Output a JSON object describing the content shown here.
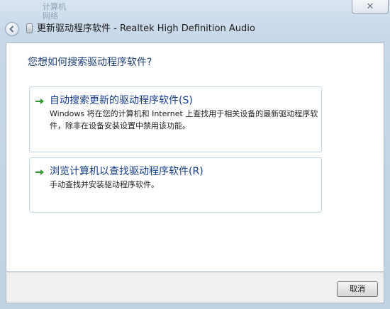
{
  "window": {
    "title": "更新驱动程序软件 - Realtek High Definition Audio",
    "background_text_1": "计算机",
    "background_text_2": "网络",
    "close_label": "✕"
  },
  "main": {
    "question": "您想如何搜索驱动程序软件?",
    "options": [
      {
        "title": "自动搜索更新的驱动程序软件(S)",
        "description": "Windows 将在您的计算机和 Internet 上查找用于相关设备的最新驱动程序软件，除非在设备安装设置中禁用该功能。",
        "icon": "green-arrow-icon"
      },
      {
        "title": "浏览计算机以查找驱动程序软件(R)",
        "description": "手动查找并安装驱动程序软件。",
        "icon": "green-arrow-icon"
      }
    ]
  },
  "footer": {
    "cancel_label": "取消"
  },
  "colors": {
    "link": "#143c8c",
    "heading": "#1e3f7a",
    "arrow": "#2f9a2f"
  }
}
